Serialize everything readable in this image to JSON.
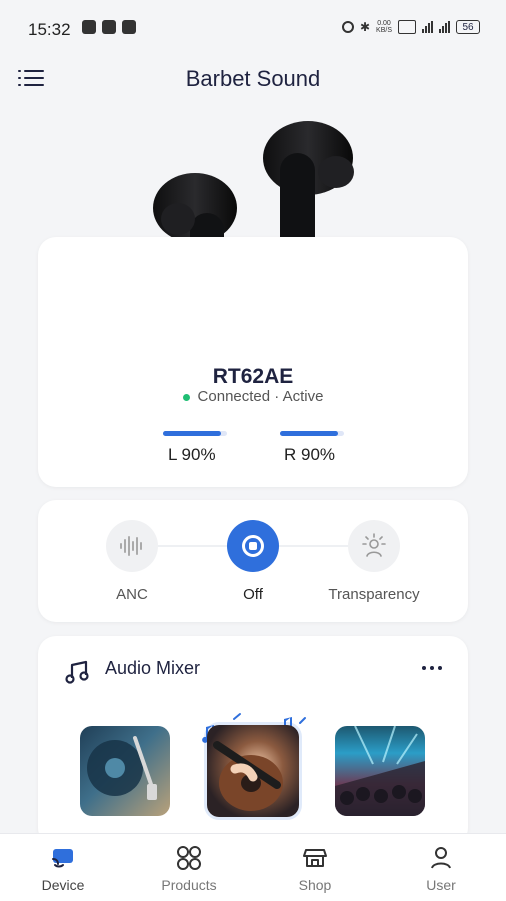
{
  "status": {
    "time": "15:32",
    "net_speed": "0.00\nKB/S",
    "battery": "56"
  },
  "header": {
    "title": "Barbet Sound"
  },
  "device": {
    "name": "RT62AE",
    "status_text": "Connected · Active",
    "status_color": "#1fbe73",
    "left_label": "L 90%",
    "right_label": "R 90%",
    "left_level": 0.9,
    "right_level": 0.9
  },
  "anc": {
    "options": [
      "ANC",
      "Off",
      "Transparency"
    ],
    "selected": "Off",
    "accent": "#2f6fdc"
  },
  "mixer": {
    "title": "Audio Mixer",
    "icons": [
      "music-icon",
      "more-icon"
    ]
  },
  "bottom_nav": {
    "items": [
      {
        "label": "Device",
        "icon": "device-icon",
        "active": true
      },
      {
        "label": "Products",
        "icon": "products-icon",
        "active": false
      },
      {
        "label": "Shop",
        "icon": "shop-icon",
        "active": false
      },
      {
        "label": "User",
        "icon": "user-icon",
        "active": false
      }
    ]
  }
}
